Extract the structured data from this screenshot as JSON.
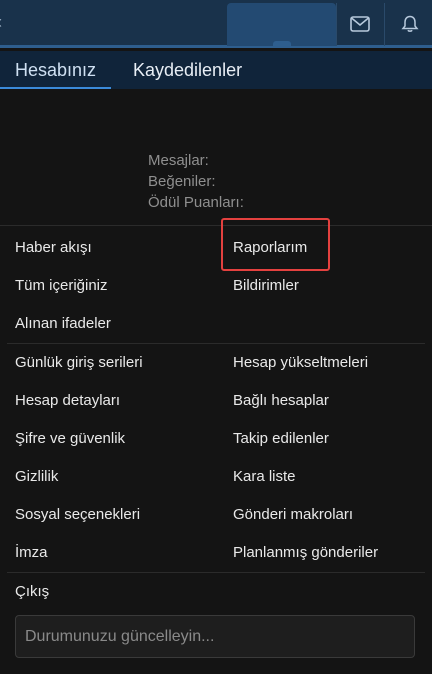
{
  "tabs": [
    "Hesabınız",
    "Kaydedilenler"
  ],
  "stats": {
    "messages_label": "Mesajlar:",
    "likes_label": "Beğeniler:",
    "points_label": "Ödül Puanları:"
  },
  "menu": {
    "group1": [
      {
        "left": "Haber akışı",
        "right": "Raporlarım"
      },
      {
        "left": "Tüm içeriğiniz",
        "right": "Bildirimler"
      },
      {
        "left": "Alınan ifadeler",
        "right": ""
      }
    ],
    "group2": [
      {
        "left": "Günlük giriş serileri",
        "right": "Hesap yükseltmeleri"
      },
      {
        "left": "Hesap detayları",
        "right": "Bağlı hesaplar"
      },
      {
        "left": "Şifre ve güvenlik",
        "right": "Takip edilenler"
      },
      {
        "left": "Gizlilik",
        "right": "Kara liste"
      },
      {
        "left": "Sosyal seçenekleri",
        "right": "Gönderi makroları"
      },
      {
        "left": "İmza",
        "right": "Planlanmış gönderiler"
      }
    ],
    "logout": "Çıkış"
  },
  "status": {
    "placeholder": "Durumunuzu güncelleyin..."
  },
  "icons": {
    "topbar": [
      "mail-icon",
      "bell-icon"
    ]
  },
  "colors": {
    "highlight": "#e4413f",
    "accent": "#3b8ad9"
  }
}
